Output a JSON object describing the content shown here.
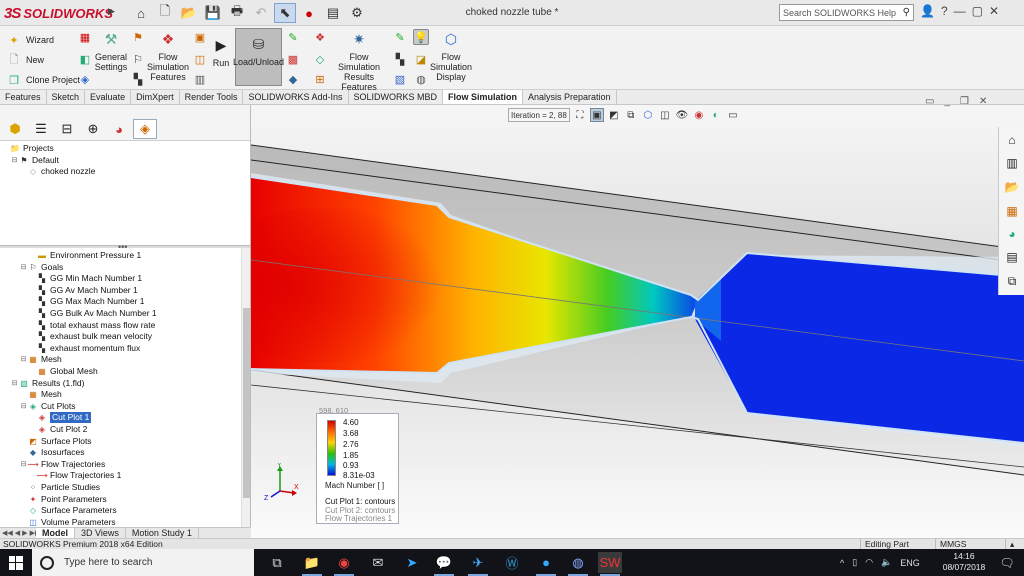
{
  "window": {
    "title": "choked nozzle tube *"
  },
  "brand": {
    "ds": "3S",
    "name": "SOLIDWORKS"
  },
  "search": {
    "placeholder": "Search SOLIDWORKS Help"
  },
  "commands": {
    "wizard": "Wizard",
    "new": "New",
    "clone": "Clone Project",
    "general_settings": [
      "General",
      "Settings"
    ],
    "fs_features": [
      "Flow",
      "Simulation",
      "Features"
    ],
    "run": "Run",
    "load_unload": "Load/Unload",
    "fs_results": [
      "Flow Simulation",
      "Results Features"
    ],
    "fs_display": [
      "Flow",
      "Simulation",
      "Display"
    ]
  },
  "tabs": [
    "Features",
    "Sketch",
    "Evaluate",
    "DimXpert",
    "Render Tools",
    "SOLIDWORKS Add-Ins",
    "SOLIDWORKS MBD",
    "Flow Simulation",
    "Analysis Preparation"
  ],
  "active_tab": "Flow Simulation",
  "view_toolbar": {
    "iteration_label": "Iteration = 2, 88"
  },
  "tree_top": [
    {
      "label": "Projects",
      "indent": 0,
      "icon": "folder-icon",
      "toggle": ""
    },
    {
      "label": "Default",
      "indent": 1,
      "icon": "flag-icon",
      "toggle": "⊟"
    },
    {
      "label": "choked nozzle",
      "indent": 2,
      "icon": "part-icon",
      "toggle": ""
    }
  ],
  "tree_bottom": [
    {
      "label": "Environment Pressure 1",
      "indent": 3,
      "icon": "condition-icon",
      "toggle": ""
    },
    {
      "label": "Goals",
      "indent": 2,
      "icon": "goal-folder-icon",
      "toggle": "⊟"
    },
    {
      "label": "GG Min Mach Number 1",
      "indent": 3,
      "icon": "goal-icon",
      "toggle": ""
    },
    {
      "label": "GG Av Mach Number 1",
      "indent": 3,
      "icon": "goal-icon",
      "toggle": ""
    },
    {
      "label": "GG Max Mach Number 1",
      "indent": 3,
      "icon": "goal-icon",
      "toggle": ""
    },
    {
      "label": "GG Bulk Av Mach Number 1",
      "indent": 3,
      "icon": "goal-icon",
      "toggle": ""
    },
    {
      "label": "total exhaust mass flow rate",
      "indent": 3,
      "icon": "goal-icon",
      "toggle": ""
    },
    {
      "label": "exhaust bulk mean velocity",
      "indent": 3,
      "icon": "goal-icon",
      "toggle": ""
    },
    {
      "label": "exhaust momentum flux",
      "indent": 3,
      "icon": "goal-icon",
      "toggle": ""
    },
    {
      "label": "Mesh",
      "indent": 2,
      "icon": "mesh-folder-icon",
      "toggle": "⊟"
    },
    {
      "label": "Global Mesh",
      "indent": 3,
      "icon": "mesh-icon",
      "toggle": ""
    },
    {
      "label": "Results (1.fld)",
      "indent": 1,
      "icon": "results-icon",
      "toggle": "⊟"
    },
    {
      "label": "Mesh",
      "indent": 2,
      "icon": "mesh-icon",
      "toggle": ""
    },
    {
      "label": "Cut Plots",
      "indent": 2,
      "icon": "cutplot-folder-icon",
      "toggle": "⊟"
    },
    {
      "label": "Cut Plot 1",
      "indent": 3,
      "icon": "cutplot-icon",
      "toggle": "",
      "selected": true
    },
    {
      "label": "Cut Plot 2",
      "indent": 3,
      "icon": "cutplot-icon",
      "toggle": ""
    },
    {
      "label": "Surface Plots",
      "indent": 2,
      "icon": "surfaceplot-icon",
      "toggle": ""
    },
    {
      "label": "Isosurfaces",
      "indent": 2,
      "icon": "isosurface-icon",
      "toggle": ""
    },
    {
      "label": "Flow Trajectories",
      "indent": 2,
      "icon": "trajectory-folder-icon",
      "toggle": "⊟"
    },
    {
      "label": "Flow Trajectories 1",
      "indent": 3,
      "icon": "trajectory-icon",
      "toggle": ""
    },
    {
      "label": "Particle Studies",
      "indent": 2,
      "icon": "particle-icon",
      "toggle": ""
    },
    {
      "label": "Point Parameters",
      "indent": 2,
      "icon": "point-param-icon",
      "toggle": ""
    },
    {
      "label": "Surface Parameters",
      "indent": 2,
      "icon": "surface-param-icon",
      "toggle": ""
    },
    {
      "label": "Volume Parameters",
      "indent": 2,
      "icon": "volume-param-icon",
      "toggle": ""
    }
  ],
  "bottom_tabs": [
    "Model",
    "3D Views",
    "Motion Study 1"
  ],
  "legend": {
    "header": "598, 610",
    "ticks": [
      "4.60",
      "3.68",
      "2.76",
      "1.85",
      "0.93",
      "8.31e-03"
    ],
    "unit": "Mach Number [ ]",
    "plots": [
      "Cut Plot 1: contours",
      "Cut Plot 2: contours",
      "Flow Trajectories 1"
    ],
    "colors": [
      "#d40000",
      "#ff6a00",
      "#ffd200",
      "#2ec000",
      "#00b8e0",
      "#0010e0"
    ]
  },
  "status": {
    "product": "SOLIDWORKS Premium 2018 x64 Edition",
    "mode": "Editing Part",
    "units": "MMGS"
  },
  "taskbar": {
    "search_placeholder": "Type here to search",
    "lang": "ENG",
    "time": "14:16",
    "date": "08/07/2018"
  }
}
